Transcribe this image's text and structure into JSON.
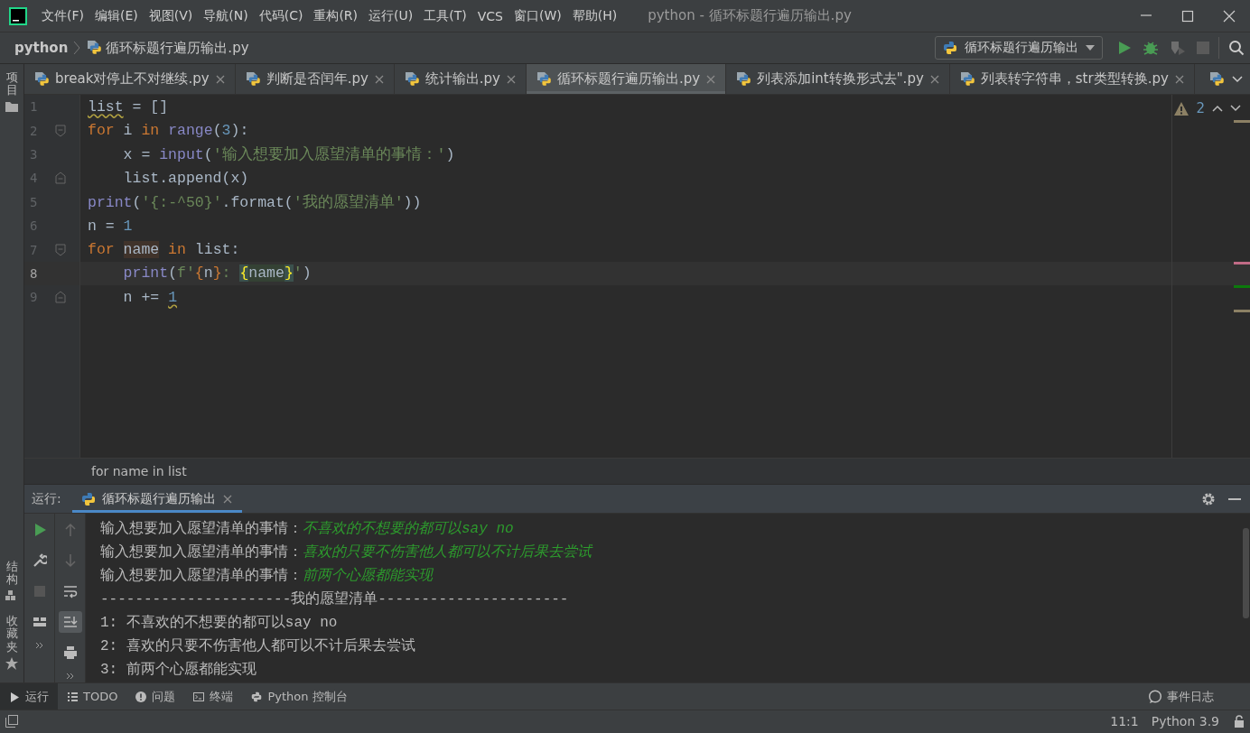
{
  "menu": [
    "文件(F)",
    "编辑(E)",
    "视图(V)",
    "导航(N)",
    "代码(C)",
    "重构(R)",
    "运行(U)",
    "工具(T)",
    "VCS",
    "窗口(W)",
    "帮助(H)"
  ],
  "window": {
    "title": "python - 循环标题行遍历输出.py"
  },
  "breadcrumb": {
    "project": "python",
    "file": "循环标题行遍历输出.py"
  },
  "run_config": {
    "label": "循环标题行遍历输出"
  },
  "side_left": {
    "top": "项目",
    "bottom": [
      "结构",
      "收藏夹"
    ]
  },
  "tabs": [
    {
      "label": "break对停止不对继续.py",
      "selected": false
    },
    {
      "label": "判断是否闰年.py",
      "selected": false
    },
    {
      "label": "统计输出.py",
      "selected": false
    },
    {
      "label": "循环标题行遍历输出.py",
      "selected": true
    },
    {
      "label": "列表添加int转换形式去\".py",
      "selected": false
    },
    {
      "label": "列表转字符串，str类型转换.py",
      "selected": false
    }
  ],
  "inspections": {
    "warnings": "2"
  },
  "code": [
    {
      "num": "1",
      "selected": false,
      "fold_start": false,
      "fold_end": false,
      "tokens": [
        {
          "t": "list",
          "kind": "warn"
        },
        {
          "t": " = []",
          "kind": "plain"
        }
      ]
    },
    {
      "num": "2",
      "selected": false,
      "fold_start": true,
      "fold_end": false,
      "tokens": [
        {
          "t": "for",
          "kind": "kw"
        },
        {
          "t": " i ",
          "kind": "plain"
        },
        {
          "t": "in",
          "kind": "kw"
        },
        {
          "t": " range",
          "kind": "fn"
        },
        {
          "t": "(",
          "kind": "plain"
        },
        {
          "t": "3",
          "kind": "num"
        },
        {
          "t": "):",
          "kind": "plain"
        }
      ]
    },
    {
      "num": "3",
      "selected": false,
      "fold_start": false,
      "fold_end": false,
      "tokens": [
        {
          "t": "    x = ",
          "kind": "plain"
        },
        {
          "t": "input",
          "kind": "fn"
        },
        {
          "t": "(",
          "kind": "plain"
        },
        {
          "t": "'输入想要加入愿望清单的事情：'",
          "kind": "str"
        },
        {
          "t": ")",
          "kind": "plain"
        }
      ]
    },
    {
      "num": "4",
      "selected": false,
      "fold_start": false,
      "fold_end": true,
      "tokens": [
        {
          "t": "    list.append(x)",
          "kind": "plain"
        }
      ]
    },
    {
      "num": "5",
      "selected": false,
      "fold_start": false,
      "fold_end": false,
      "tokens": [
        {
          "t": "print",
          "kind": "fn"
        },
        {
          "t": "(",
          "kind": "plain"
        },
        {
          "t": "'{:-^50}'",
          "kind": "str"
        },
        {
          "t": ".format(",
          "kind": "plain"
        },
        {
          "t": "'我的愿望清单'",
          "kind": "str"
        },
        {
          "t": "))",
          "kind": "plain"
        }
      ]
    },
    {
      "num": "6",
      "selected": false,
      "fold_start": false,
      "fold_end": false,
      "tokens": [
        {
          "t": "n = ",
          "kind": "plain"
        },
        {
          "t": "1",
          "kind": "num"
        }
      ]
    },
    {
      "num": "7",
      "selected": false,
      "fold_start": true,
      "fold_end": false,
      "tokens": [
        {
          "t": "for ",
          "kind": "kw"
        },
        {
          "t": "name",
          "kind": "hl"
        },
        {
          "t": " in",
          "kind": "kw"
        },
        {
          "t": " list:",
          "kind": "plain"
        }
      ]
    },
    {
      "num": "8",
      "selected": true,
      "fold_start": false,
      "fold_end": false,
      "tokens": [
        {
          "t": "    print",
          "kind": "fn"
        },
        {
          "t": "(",
          "kind": "plain"
        },
        {
          "t": "f'",
          "kind": "str"
        },
        {
          "t": "{",
          "kind": "kw"
        },
        {
          "t": "n",
          "kind": "plain"
        },
        {
          "t": "}",
          "kind": "kw"
        },
        {
          "t": ": ",
          "kind": "str"
        },
        {
          "t": "{",
          "kind": "brace"
        },
        {
          "t": "name",
          "kind": "match"
        },
        {
          "t": "}",
          "kind": "brace"
        },
        {
          "t": "'",
          "kind": "str"
        },
        {
          "t": ")",
          "kind": "plain"
        }
      ]
    },
    {
      "num": "9",
      "selected": false,
      "fold_start": false,
      "fold_end": true,
      "tokens": [
        {
          "t": "    n += ",
          "kind": "plain"
        },
        {
          "t": "1",
          "kind": "numwarn"
        }
      ]
    }
  ],
  "stripe_marks": [
    {
      "color": "#8c8064"
    },
    {
      "color": "#c06b86"
    },
    {
      "color": "#0b7a0b"
    },
    {
      "color": "#8c8064"
    }
  ],
  "scope_path": "for name in list",
  "run_panel": {
    "label": "运行:",
    "tab": "循环标题行遍历输出"
  },
  "output": [
    {
      "kind": "prompt",
      "prompt": "输入想要加入愿望清单的事情：",
      "input": "不喜欢的不想要的都可以say no"
    },
    {
      "kind": "prompt",
      "prompt": "输入想要加入愿望清单的事情：",
      "input": "喜欢的只要不伤害他人都可以不计后果去尝试"
    },
    {
      "kind": "prompt",
      "prompt": "输入想要加入愿望清单的事情：",
      "input": "前两个心愿都能实现"
    },
    {
      "kind": "out",
      "text": "----------------------我的愿望清单----------------------"
    },
    {
      "kind": "out",
      "text": "1: 不喜欢的不想要的都可以say no"
    },
    {
      "kind": "out",
      "text": "2: 喜欢的只要不伤害他人都可以不计后果去尝试"
    },
    {
      "kind": "out",
      "text": "3: 前两个心愿都能实现"
    }
  ],
  "tool_windows": [
    {
      "label": "运行",
      "kind": "run",
      "selected": true
    },
    {
      "label": "TODO",
      "kind": "todo",
      "selected": false
    },
    {
      "label": "问题",
      "kind": "problems",
      "selected": false
    },
    {
      "label": "终端",
      "kind": "terminal",
      "selected": false
    },
    {
      "label": "Python 控制台",
      "kind": "console",
      "selected": false
    }
  ],
  "event_log": "事件日志",
  "status": {
    "position": "11:1",
    "interpreter": "Python 3.9"
  }
}
